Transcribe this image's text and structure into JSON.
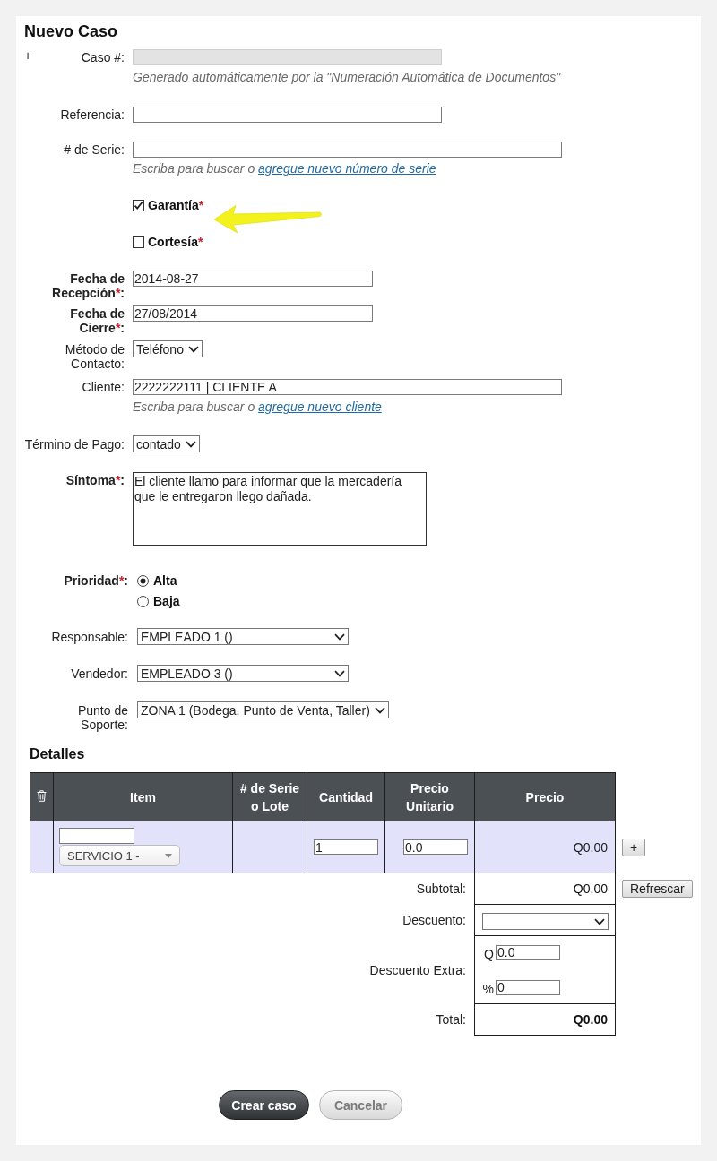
{
  "title": "Nuevo Caso",
  "expand_toggle": "+",
  "case_number": {
    "label": "Caso #:",
    "disabled": true,
    "hint": "Generado automáticamente por la \"Numeración Automática de Documentos\""
  },
  "reference": {
    "label": "Referencia:"
  },
  "serial": {
    "label": "# de Serie:",
    "hint": "Escriba para buscar o",
    "link": "agregue nuevo número de serie"
  },
  "flags": [
    {
      "label": "Garantía",
      "required_mark": "*",
      "checked": true
    },
    {
      "label": "Cortesía",
      "required_mark": "*",
      "checked": false
    }
  ],
  "reception_date": {
    "label": "Fecha de Recepción",
    "required_mark": "*",
    "suffix": ":",
    "value": "2014-08-27"
  },
  "closing_date": {
    "label": "Fecha de Cierre",
    "required_mark": "*",
    "suffix": ":",
    "value": "27/08/2014"
  },
  "contact_method": {
    "label": "Método de Contacto:",
    "value": "Teléfono"
  },
  "client": {
    "label": "Cliente:",
    "value": "2222222111 | CLIENTE A",
    "hint": "Escriba para buscar o",
    "link": "agregue nuevo cliente"
  },
  "payment_term": {
    "label": "Término de Pago:",
    "value": "contado"
  },
  "symptom": {
    "label": "Síntoma",
    "required_mark": "*",
    "suffix": ":",
    "value": "El cliente llamo para informar que la mercadería que le entregaron llego dañada."
  },
  "priority": {
    "label": "Prioridad",
    "required_mark": "*",
    "suffix": ":",
    "options": [
      {
        "label": "Alta",
        "selected": true
      },
      {
        "label": "Baja",
        "selected": false
      }
    ]
  },
  "responsible": {
    "label": "Responsable:",
    "value": "EMPLEADO 1 ()"
  },
  "seller": {
    "label": "Vendedor:",
    "value": "EMPLEADO 3 ()"
  },
  "support_point": {
    "label": "Punto de Soporte:",
    "value": "ZONA 1 (Bodega, Punto de Venta, Taller)"
  },
  "details": {
    "title": "Detalles",
    "columns": [
      "Item",
      "# de Serie o Lote",
      "Cantidad",
      "Precio Unitario",
      "Precio"
    ],
    "rows": [
      {
        "item": "SERVICIO 1 -",
        "quantity": "1",
        "unit_price": "0.0",
        "price": "Q0.00"
      }
    ],
    "add_button": "+"
  },
  "summary": [
    {
      "kind": "amount",
      "label": "Subtotal:",
      "value": "Q0.00"
    },
    {
      "kind": "select",
      "label": "Descuento:"
    },
    {
      "kind": "extra",
      "label": "Descuento Extra:",
      "inputs": [
        {
          "prefix": "Q",
          "value": "0.0"
        },
        {
          "prefix": "%",
          "value": "0"
        }
      ]
    },
    {
      "kind": "total",
      "label": "Total:",
      "value": "Q0.00"
    }
  ],
  "refresh_button": "Refrescar",
  "actions": [
    {
      "kind": "primary",
      "label": "Crear caso"
    },
    {
      "kind": "secondary",
      "label": "Cancelar"
    }
  ]
}
